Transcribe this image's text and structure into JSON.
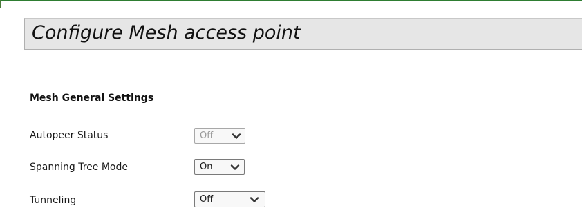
{
  "page": {
    "title": "Configure Mesh access point"
  },
  "section": {
    "heading": "Mesh General Settings"
  },
  "settings": [
    {
      "label": "Autopeer Status",
      "value": "Off",
      "disabled": true
    },
    {
      "label": "Spanning Tree Mode",
      "value": "On",
      "disabled": false
    },
    {
      "label": "Tunneling",
      "value": "Off",
      "disabled": false
    }
  ],
  "colors": {
    "accent_rule": "#2e7d32",
    "title_bar_bg": "#e6e6e6",
    "disabled_text": "#9a9a9a"
  },
  "icons": {
    "dropdown": "chevron-down-icon"
  }
}
